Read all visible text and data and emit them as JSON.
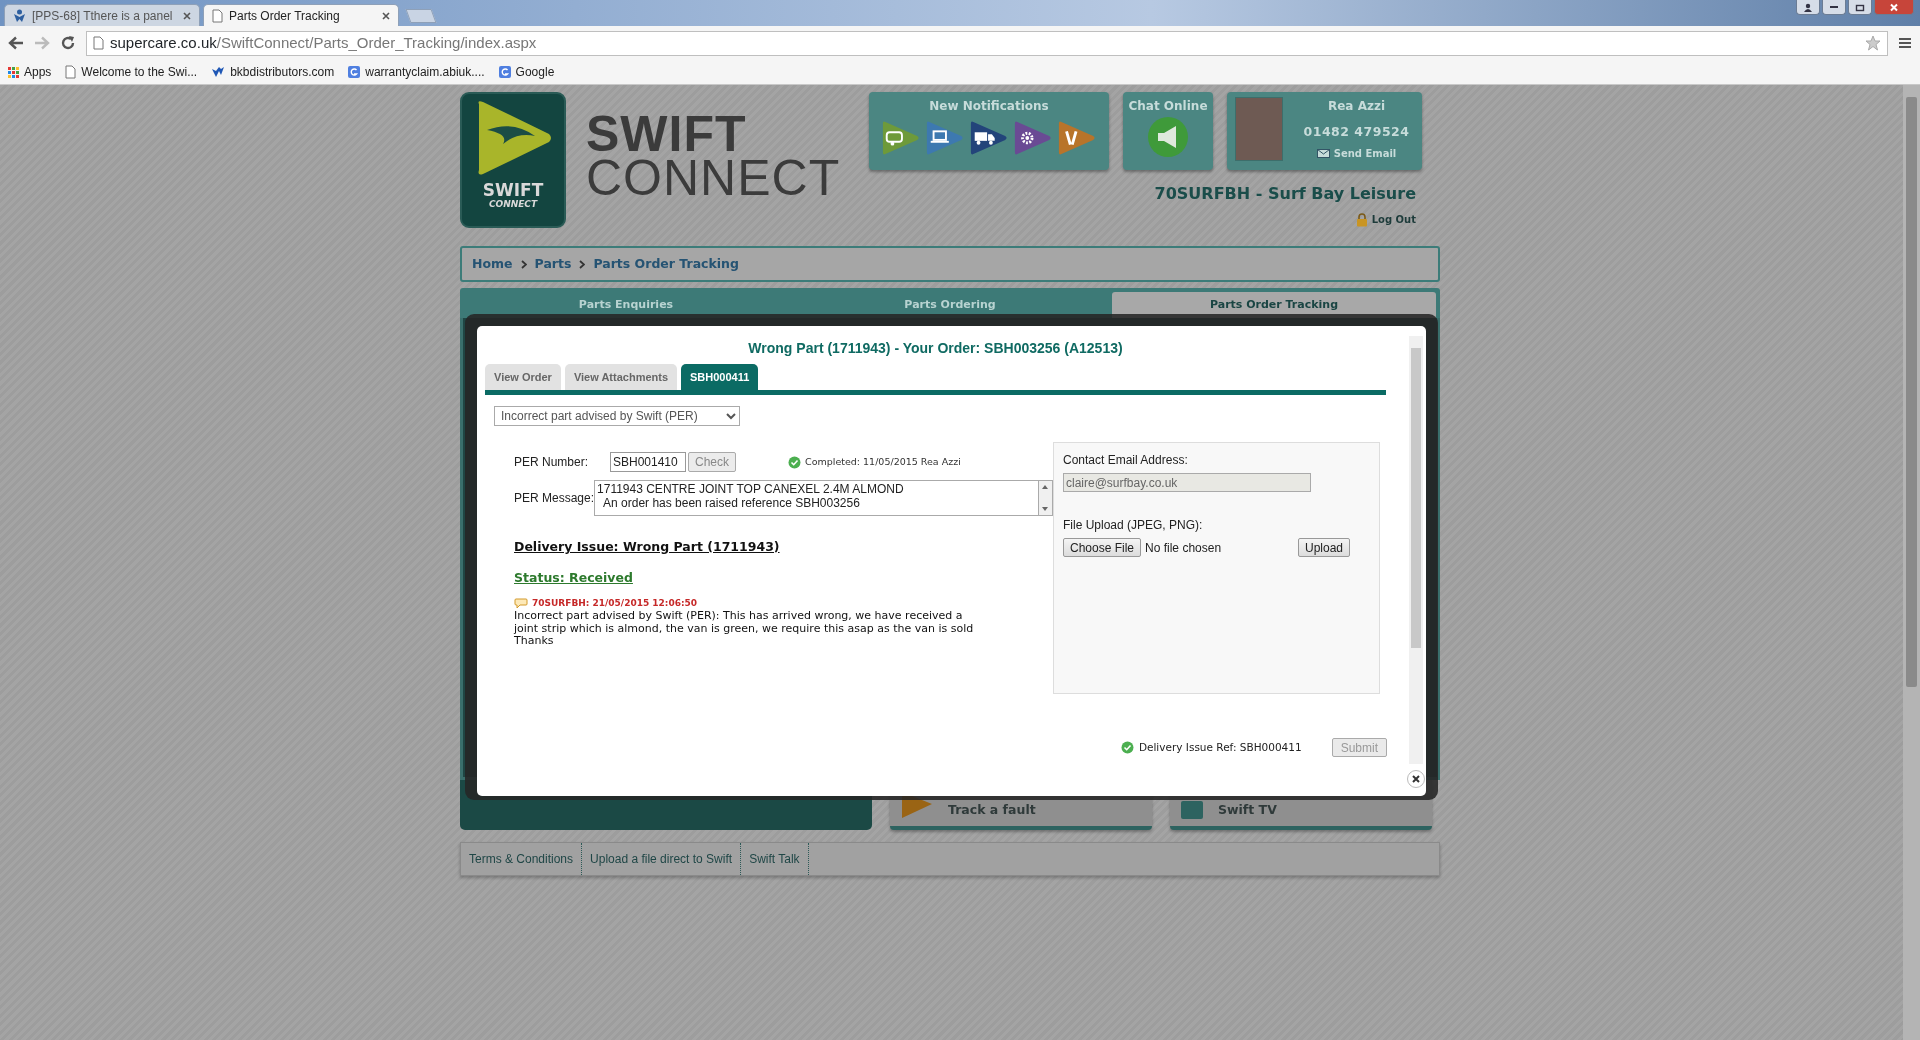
{
  "browser": {
    "tabs": [
      {
        "title": "[PPS-68] Tthere is a panel",
        "kind": "app",
        "selected": false
      },
      {
        "title": "Parts Order Tracking",
        "kind": "page",
        "selected": true
      }
    ],
    "address": {
      "host": "supercare.co.uk",
      "path": "/SwiftConnect/Parts_Order_Tracking/index.aspx"
    },
    "bookmarks": [
      {
        "label": "Apps",
        "kind": "apps"
      },
      {
        "label": "Welcome to the Swi...",
        "kind": "page"
      },
      {
        "label": "bkbdistributors.com",
        "kind": "brand"
      },
      {
        "label": "warrantyclaim.abiuk....",
        "kind": "google"
      },
      {
        "label": "Google",
        "kind": "google"
      }
    ]
  },
  "header": {
    "logo_badge": [
      "SWIFT",
      "CONNECT"
    ],
    "logo_text": [
      "SWIFT",
      "CONNECT"
    ],
    "notifications_title": "New Notifications",
    "chat_title": "Chat Online",
    "profile": {
      "name": "Rea Azzi",
      "phone": "01482 479524",
      "email_link": "Send Email"
    },
    "account": "70SURFBH - Surf Bay Leisure",
    "logout": "Log Out"
  },
  "breadcrumb": [
    "Home",
    "Parts",
    "Parts Order Tracking"
  ],
  "main_tabs": [
    {
      "label": "Parts Enquiries",
      "selected": false
    },
    {
      "label": "Parts Ordering",
      "selected": false
    },
    {
      "label": "Parts Order Tracking",
      "selected": true
    }
  ],
  "tiles": [
    {
      "label": "Track a fault",
      "kind": "fault"
    },
    {
      "label": "Swift TV",
      "kind": "tv"
    }
  ],
  "footer_links": [
    "Terms & Conditions",
    "Upload a file direct to Swift",
    "Swift Talk"
  ],
  "modal": {
    "title": "Wrong Part (1711943) - Your Order: SBH003256 (A12513)",
    "tabs": [
      {
        "label": "View Order",
        "selected": false
      },
      {
        "label": "View Attachments",
        "selected": false
      },
      {
        "label": "SBH000411",
        "selected": true
      }
    ],
    "issue_type": "Incorrect part advised by Swift (PER)",
    "per_number": {
      "label": "PER Number:",
      "value": "SBH001410",
      "check_button": "Check",
      "check_disabled": true,
      "status": "Completed: 11/05/2015 Rea Azzi"
    },
    "per_message": {
      "label": "PER Message:",
      "lines": [
        "1711943 CENTRE JOINT TOP CANEXEL 2.4M ALMOND",
        "  An order has been raised reference SBH003256"
      ]
    },
    "heading": "Delivery Issue: Wrong Part (1711943)",
    "status": "Status: Received",
    "comments": [
      {
        "author": "70SURFBH: 21/05/2015 12:06:50",
        "text": "Incorrect part advised by Swift (PER): This has arrived wrong, we have received a joint strip which is almond, the van is green, we require this asap as the van is sold Thanks"
      }
    ],
    "contact": {
      "label": "Contact Email Address:",
      "value": "claire@surfbay.co.uk"
    },
    "upload": {
      "label": "File Upload (JPEG, PNG):",
      "choose_button": "Choose File",
      "file_name": "No file chosen",
      "upload_button": "Upload"
    },
    "reference": "Delivery Issue Ref: SBH000411",
    "submit": {
      "label": "Submit",
      "disabled": true
    }
  }
}
